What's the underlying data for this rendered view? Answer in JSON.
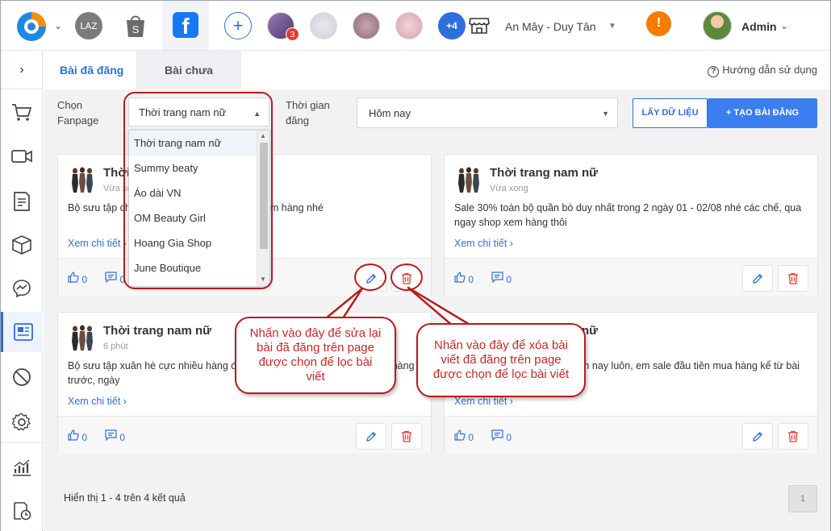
{
  "topbar": {
    "channels": [
      {
        "name": "lazada",
        "label": "LAZ"
      },
      {
        "name": "shopee",
        "label": "S"
      },
      {
        "name": "facebook",
        "label": "f"
      }
    ],
    "pages_badge": "3",
    "more_label": "+4",
    "shop_name": "An Mây - Duy Tân",
    "warning_symbol": "!",
    "user_name": "Admin"
  },
  "tabs": [
    {
      "label": "Bài đã đăng",
      "active": true
    },
    {
      "label": "Bài chưa đăng",
      "active": false
    }
  ],
  "help_label": "Hướng dẫn sử dụng",
  "filters": {
    "fanpage_label": "Chọn Fanpage",
    "fanpage_value": "Thời trang nam nữ",
    "time_label": "Thời gian đăng",
    "time_value": "Hôm nay",
    "fetch_button": "LẤY DỮ LIỆU",
    "create_button": "TẠO BÀI ĐĂNG"
  },
  "dropdown_options": [
    "Thời trang nam nữ",
    "Summy beaty",
    "Áo dài VN",
    "OM Beauty Girl",
    "Hoang Gia Shop",
    "June Boutique"
  ],
  "posts": [
    {
      "title": "Thời trang nam nữ",
      "time": "Vừa xong",
      "text": "Bộ sưu tập cho các tình iu, qua ngay shop xem hàng nhé",
      "more": "Xem chi tiết",
      "likes": "0",
      "comments": "0"
    },
    {
      "title": "Thời trang nam nữ",
      "time": "Vừa xong",
      "text": "Sale 30% toàn bộ quần bò duy nhất trong 2 ngày 01 - 02/08 nhé các chế, qua ngay shop xem hàng thôi",
      "more": "Xem chi tiết",
      "likes": "0",
      "comments": "0"
    },
    {
      "title": "Thời trang nam nữ",
      "time": "6 phút",
      "text": "Bộ sưu tập xuân hè cực nhiều hàng đẹp, trả hàng cho các tình iu đã đặt hàng trước, ngày",
      "more": "Xem chi tiết",
      "likes": "0",
      "comments": "0"
    },
    {
      "title": "Thời trang nam nữ",
      "time": "",
      "text": "chế, toàn các mẫu hot hit năm nay luôn, em sale đầu tiên mua hàng kể từ bài viết này nhá, nhanh",
      "more": "Xem chi tiết",
      "likes": "0",
      "comments": "0"
    }
  ],
  "results_text": "Hiển thị 1 - 4 trên 4 kết quả",
  "page_number": "1",
  "callouts": {
    "edit": "Nhấn vào đây để sửa lại bài đã đăng trên page được chọn để lọc bài viết",
    "delete": "Nhấn vào đây để xóa bài viết đã đăng trên page được chọn để lọc bài viết"
  },
  "colors": {
    "accent": "#2f6fdb",
    "annotation": "#b71c1c",
    "delete_icon": "#e53935"
  }
}
